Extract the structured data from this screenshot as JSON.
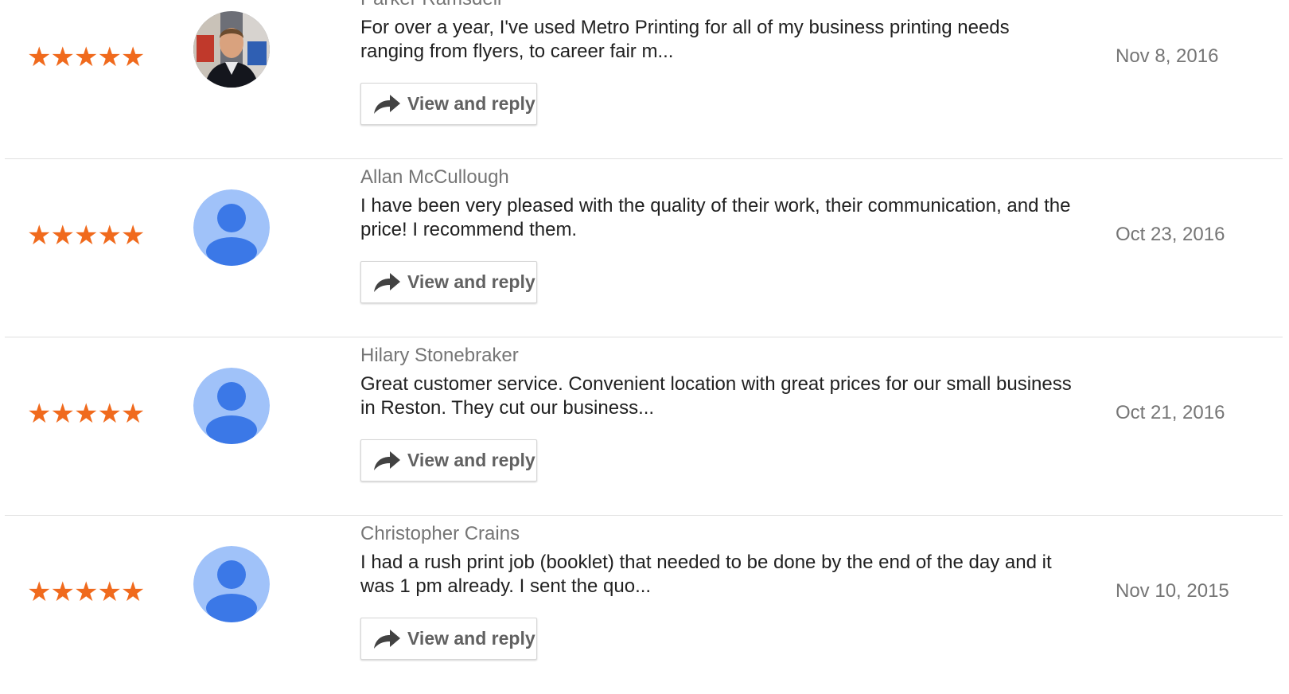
{
  "reviews": [
    {
      "author": "Parker Ramsdell",
      "text": "For over a year, I've used Metro Printing for all of my business printing needs ranging from flyers, to career fair m...",
      "date": "Nov 8, 2016",
      "stars": "★★★★★",
      "rating": 5,
      "avatar": "photo-avatar",
      "reply_label": "View and reply"
    },
    {
      "author": "Allan McCullough",
      "text": "I have been very pleased with the quality of their work, their communication, and the price! I recommend them.",
      "date": "Oct 23, 2016",
      "stars": "★★★★★",
      "rating": 5,
      "avatar": "default-user-avatar",
      "reply_label": "View and reply"
    },
    {
      "author": "Hilary Stonebraker",
      "text": "Great customer service. Convenient location with great prices for our small business in Reston. They cut our business...",
      "date": "Oct 21, 2016",
      "stars": "★★★★★",
      "rating": 5,
      "avatar": "default-user-avatar",
      "reply_label": "View and reply"
    },
    {
      "author": "Christopher Crains",
      "text": "I had a rush print job (booklet) that needed to be done by the end of the day and it was 1 pm already. I sent the quo...",
      "date": "Nov 10, 2015",
      "stars": "★★★★★",
      "rating": 5,
      "avatar": "default-user-avatar",
      "reply_label": "View and reply"
    }
  ],
  "colors": {
    "star": "#f06a1d",
    "avatar_bg": "#a0c2f9",
    "avatar_person": "#3b78e7",
    "author": "#757575",
    "text": "#212121",
    "button_text": "#616161"
  },
  "icons": {
    "reply": "reply-arrow-icon",
    "star": "star-icon"
  }
}
